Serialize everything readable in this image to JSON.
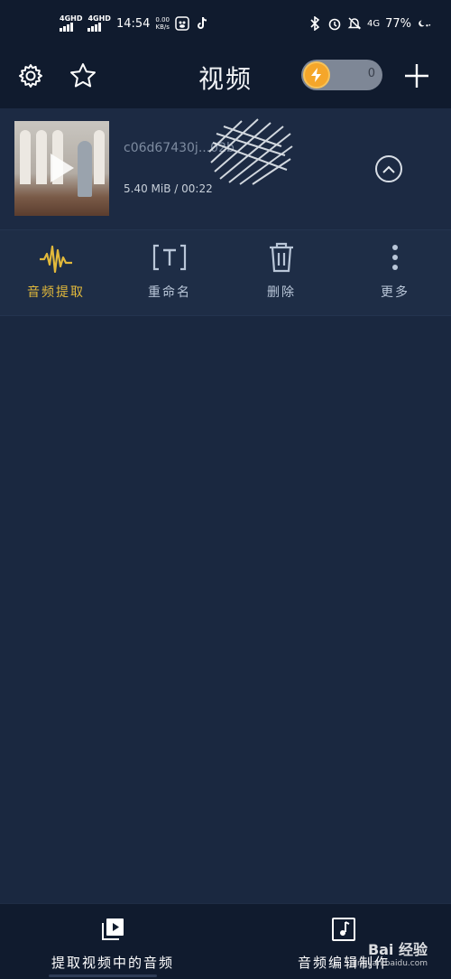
{
  "status_bar": {
    "sim1_label": "4GHD",
    "sim2_label": "4GHD",
    "time": "14:54",
    "net_speed_value": "0.00",
    "net_speed_unit": "KB/s",
    "network_type": "4G",
    "battery_percent": "77%",
    "icons": [
      "baidu-app-icon",
      "tiktok-icon",
      "bluetooth-icon",
      "alarm-icon",
      "mute-icon",
      "moon-icon"
    ]
  },
  "header": {
    "title": "视频",
    "energy_count": "0",
    "accent_color": "#f5a62a"
  },
  "video": {
    "file_name": "c06d67430j...02b",
    "meta": "5.40 MiB / 00:22"
  },
  "actions": [
    {
      "label": "音频提取",
      "icon": "waveform-icon",
      "color": "#e2b93b"
    },
    {
      "label": "重命名",
      "icon": "text-rename-icon"
    },
    {
      "label": "删除",
      "icon": "trash-icon"
    },
    {
      "label": "更多",
      "icon": "more-vertical-icon"
    }
  ],
  "bottom_nav": {
    "item1_label": "提取视频中的音频",
    "item2_label": "音频编辑制作"
  },
  "watermark": {
    "brand": "Bai 经验",
    "url": "jingyan.baidu.com"
  }
}
